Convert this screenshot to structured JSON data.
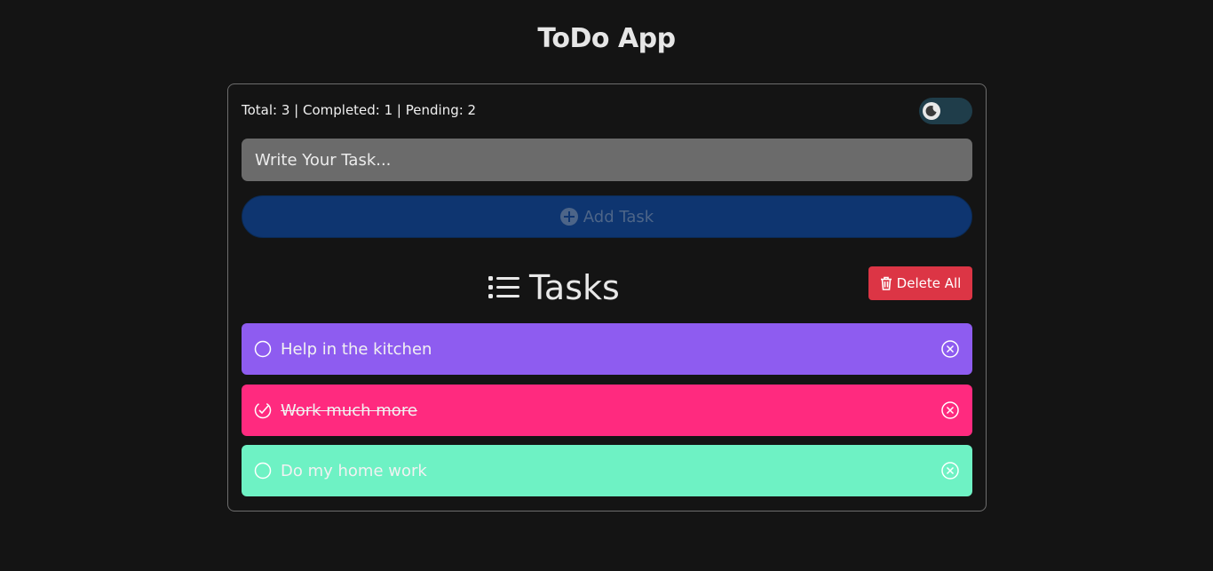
{
  "app": {
    "title": "ToDo App"
  },
  "stats": {
    "text": "Total: 3 | Completed: 1 | Pending: 2"
  },
  "theme_toggle": {
    "icon": "moon-icon"
  },
  "input": {
    "placeholder": "Write Your Task...",
    "value": ""
  },
  "add_button": {
    "label": "Add Task",
    "icon": "plus-circle-icon"
  },
  "tasks_section": {
    "heading": "Tasks",
    "icon": "list-icon"
  },
  "delete_all": {
    "label": "Delete All",
    "icon": "trash-icon"
  },
  "tasks": [
    {
      "text": "Help in the kitchen",
      "completed": false,
      "color": "#8e5cf0"
    },
    {
      "text": "Work much more",
      "completed": true,
      "color": "#ff2a7f"
    },
    {
      "text": "Do my home work",
      "completed": false,
      "color": "#6ef2c4"
    }
  ]
}
